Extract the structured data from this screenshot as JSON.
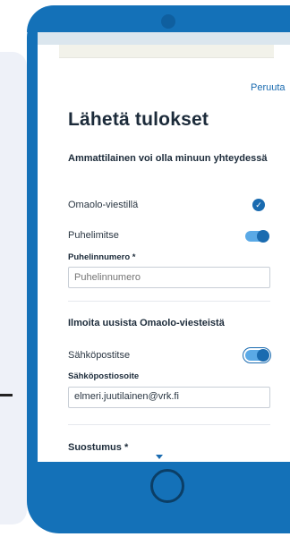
{
  "header": {
    "cancel_label": "Peruuta"
  },
  "page": {
    "title": "Lähetä tulokset"
  },
  "contact": {
    "heading": "Ammattilainen voi olla minuun yhteydessä",
    "omaolo_label": "Omaolo-viestillä",
    "phone_label": "Puhelimitse",
    "phone_field_label": "Puhelinnumero *",
    "phone_placeholder": "Puhelinnumero"
  },
  "notify": {
    "heading": "Ilmoita uusista Omaolo-viesteistä",
    "email_label": "Sähköpostitse",
    "email_field_label": "Sähköpostiosoite",
    "email_value": "elmeri.juutilainen@vrk.fi"
  },
  "consent": {
    "label": "Suostumus *"
  },
  "states": {
    "omaolo_checked": true,
    "phone_toggle_on": true,
    "email_toggle_on": true
  },
  "colors": {
    "accent": "#1a6bb0",
    "phone_body": "#1471b8"
  },
  "icons": {
    "check": "check-icon",
    "arrow": "chevron-down-icon"
  }
}
